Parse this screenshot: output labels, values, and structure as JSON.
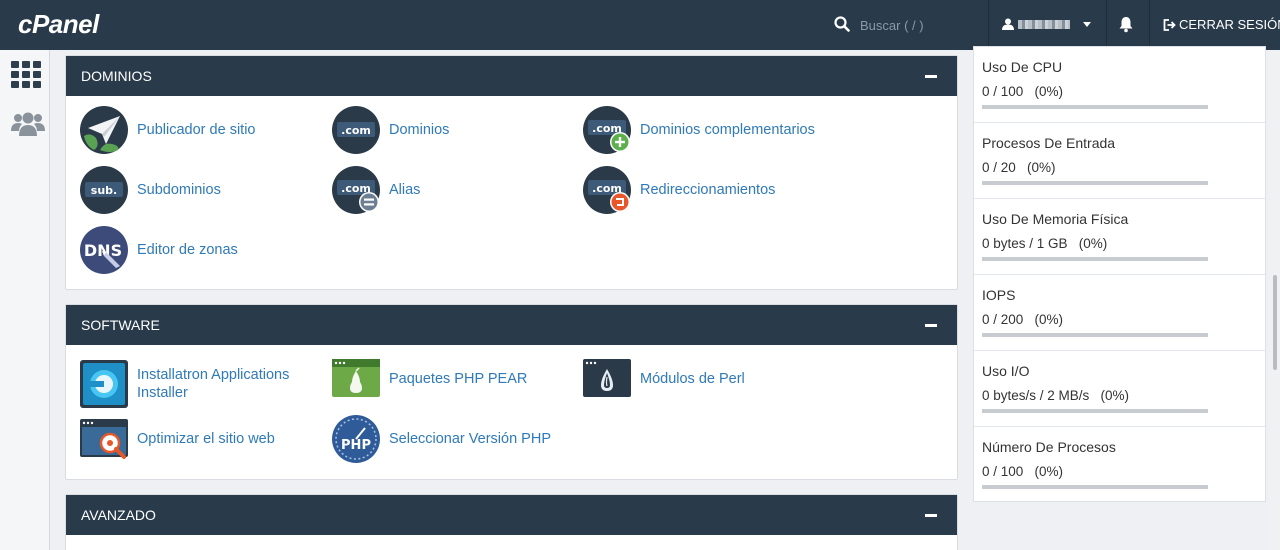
{
  "header": {
    "logo": "cPanel",
    "search_placeholder": "Buscar ( / )",
    "logout_label": "CERRAR SESIÓN"
  },
  "sections": {
    "dominios": {
      "title": "DOMINIOS",
      "items": [
        {
          "label": "Publicador de sitio"
        },
        {
          "label": "Dominios",
          "icon_text": ".com"
        },
        {
          "label": "Dominios complementarios",
          "icon_text": ".com"
        },
        {
          "label": "Subdominios",
          "icon_text": "sub."
        },
        {
          "label": "Alias",
          "icon_text": ".com"
        },
        {
          "label": "Redireccionamientos",
          "icon_text": ".com"
        },
        {
          "label": "Editor de zonas",
          "icon_text": "DNS"
        }
      ]
    },
    "software": {
      "title": "SOFTWARE",
      "items": [
        {
          "label": "Installatron Applications Installer"
        },
        {
          "label": "Paquetes PHP PEAR"
        },
        {
          "label": "Módulos de Perl"
        },
        {
          "label": "Optimizar el sitio web"
        },
        {
          "label": "Seleccionar Versión PHP",
          "icon_text": "PHP"
        }
      ]
    },
    "avanzado": {
      "title": "AVANZADO"
    }
  },
  "stats": [
    {
      "name": "Uso De CPU",
      "value": "0 / 100   (0%)",
      "percent": 0
    },
    {
      "name": "Procesos De Entrada",
      "value": "0 / 20   (0%)",
      "percent": 0
    },
    {
      "name": "Uso De Memoria Física",
      "value": "0 bytes / 1 GB   (0%)",
      "percent": 0
    },
    {
      "name": "IOPS",
      "value": "0 / 200   (0%)",
      "percent": 0
    },
    {
      "name": "Uso I/O",
      "value": "0 bytes/s / 2 MB/s   (0%)",
      "percent": 0
    },
    {
      "name": "Número De Procesos",
      "value": "0 / 100   (0%)",
      "percent": 0
    }
  ],
  "colors": {
    "header_bg": "#293a4a",
    "link": "#2f7ab8",
    "bar_track": "#c8ccd0"
  }
}
